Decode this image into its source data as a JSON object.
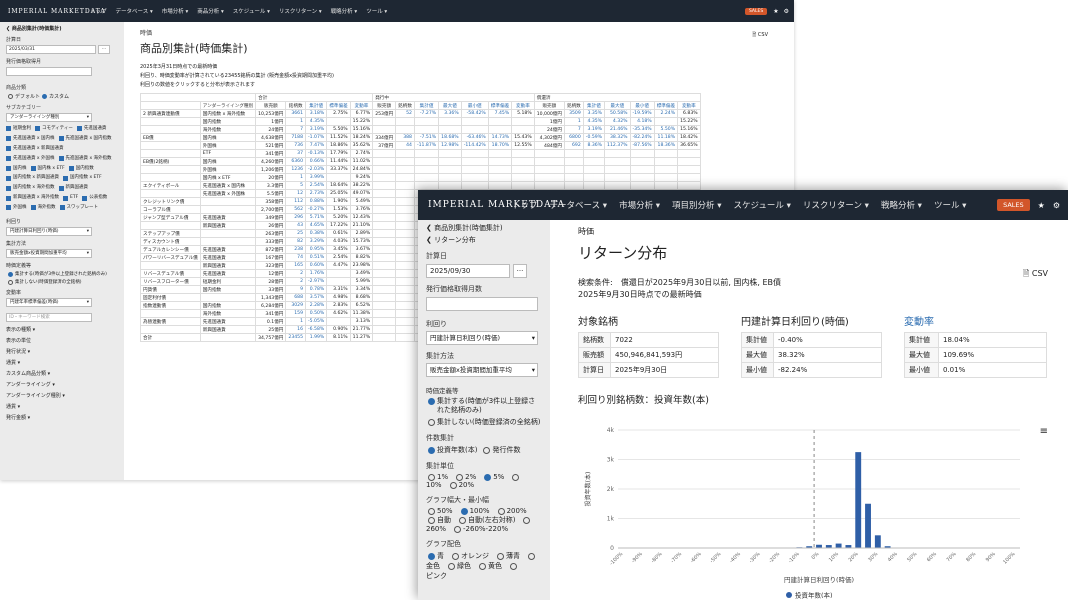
{
  "app": {
    "logo": "IMPERIAL MARKETDATA",
    "nav_small": [
      "トップ",
      "データベース ▾",
      "市場分析 ▾",
      "商品分析 ▾",
      "スケジュール ▾",
      "リスクリターン ▾",
      "戦略分析 ▾",
      "ツール ▾"
    ],
    "nav_large": [
      "トップ",
      "データベース ▾",
      "市場分析 ▾",
      "項目別分析 ▾",
      "スケジュール ▾",
      "リスクリターン ▾",
      "戦略分析 ▾",
      "ツール ▾"
    ],
    "sales": "SALES",
    "star_icon": "★",
    "gear_icon": "⚙"
  },
  "win1": {
    "sidebar": {
      "back": "❮ 商品別集計(時価集計)",
      "date_label": "計算日",
      "date_value": "2025/03/31",
      "date_btn": "...",
      "issuer_label": "発行価格取得月",
      "product_label": "商品分類",
      "product_default": "デフォルト",
      "product_custom": "カスタム",
      "subcat_label": "サブカテゴリー",
      "subcat_value": "アンダーライイング種別",
      "checks": [
        "短期金利",
        "コモディティー",
        "先進国通貨",
        "先進国通貨 x 国内株",
        "先進国通貨 x 国内指数",
        "先進国通貨 x 新興国通貨",
        "先進国通貨 x 外国株",
        "先進国通貨 x 海外指数",
        "国内株",
        "国内株 x ETF",
        "国内指数",
        "国内指数 x 新興国通貨",
        "国内指数 x ETF",
        "国内指数 x 海外指数",
        "新興国通貨",
        "新興国通貨 x 海外指数",
        "ETF",
        "公表指数",
        "外国株",
        "海外指数",
        "スワップレート"
      ],
      "yield_label": "利回り",
      "yield_value": "円建計算日利回り(時価)",
      "agg_label": "集計方法",
      "agg_value": "販売金額x投資期間加重平均",
      "period_label": "時価定義等",
      "period_opt1": "集計する(時価が3件以上登録された銘柄のみ)",
      "period_opt2": "集計しない(時価登録済の全銘柄)",
      "change_label": "変動率",
      "change_value": "円建年率標準偏差(時価)",
      "search_placeholder": "ID・キーワード検索",
      "links": [
        "表示の種類 ▾",
        "表示の単位",
        "発行状況 ▾",
        "通貨 ▾",
        "カスタム商品分類 ▾",
        "アンダーライイング ▾",
        "アンダーライイング種別 ▾",
        "通貨 ▾",
        "発行金額 ▾"
      ]
    },
    "main": {
      "subtitle": "時価",
      "title": "商品別集計(時価集計)",
      "desc1": "2025年3月31日時点での最新時価",
      "desc2": "利回り、時価変動率が計算されている23455銘柄の集計 (販売金額x投資期間加重平均)",
      "desc3": "利回りの数値をクリックすると分布が表示されます",
      "csv": "CSV",
      "group_headers": [
        "合計",
        "発行中",
        "償還済"
      ],
      "yield_header": "円建計算日利回り(時価)",
      "col_headers": [
        "アンダーライイング種別",
        "販売額",
        "銘柄数",
        "集計値",
        "標準偏差",
        "変動率",
        "最大値",
        "最小値"
      ],
      "rows": [
        [
          "2 新興通貨連動債",
          "国内指数 x 海外指数",
          "10,253億円",
          "3661",
          "3.18%",
          "2.75%",
          "6.77%"
        ],
        [
          "",
          "国内指数",
          "1億円",
          "1",
          "4.35%",
          "",
          "15.22%"
        ],
        [
          "",
          "海外指数",
          "24億円",
          "7",
          "3.19%",
          "5.50%",
          "15.16%"
        ],
        [
          "EB債",
          "国内株",
          "4,638億円",
          "7188",
          "-1.07%",
          "11.52%",
          "18.24%"
        ],
        [
          "",
          "外国株",
          "521億円",
          "736",
          "7.47%",
          "18.86%",
          "35.62%"
        ],
        [
          "",
          "ETF",
          "341億円",
          "37",
          "-0.13%",
          "17.79%",
          "2.74%"
        ],
        [
          "EB債(2銘柄)",
          "国内株",
          "4,260億円",
          "6360",
          "0.66%",
          "11.44%",
          "11.02%"
        ],
        [
          "",
          "外国株",
          "1,206億円",
          "1236",
          "-2.03%",
          "33.37%",
          "24.84%"
        ],
        [
          "",
          "国内株 x ETF",
          "20億円",
          "1",
          "3.99%",
          "",
          "9.24%"
        ],
        [
          "エクイティポール",
          "先進国通貨 x 国内株",
          "3.3億円",
          "5",
          "2.54%",
          "18.64%",
          "38.22%"
        ],
        [
          "",
          "先進国通貨 x 外国株",
          "5.5億円",
          "12",
          "2.73%",
          "25.05%",
          "49.07%"
        ],
        [
          "クレジットリンク債",
          "",
          "358億円",
          "112",
          "0.88%",
          "1.90%",
          "5.49%"
        ],
        [
          "コーラブル債",
          "",
          "2,700億円",
          "562",
          "-0.27%",
          "1.53%",
          "3.76%"
        ],
        [
          "ジャンプ型デュアル債",
          "先進国通貨",
          "349億円",
          "296",
          "5.71%",
          "5.20%",
          "12.43%"
        ],
        [
          "",
          "新興国通貨",
          "26億円",
          "43",
          "4.65%",
          "17.22%",
          "21.10%"
        ],
        [
          "ステップアップ債",
          "",
          "263億円",
          "25",
          "0.38%",
          "0.61%",
          "2.89%"
        ],
        [
          "ディスカウント債",
          "",
          "333億円",
          "82",
          "3.29%",
          "4.03%",
          "15.73%"
        ],
        [
          "デュアルカレンシー債",
          "先進国通貨",
          "872億円",
          "238",
          "0.95%",
          "3.45%",
          "3.67%"
        ],
        [
          "パワーリバースデュアル債",
          "先進国通貨",
          "167億円",
          "74",
          "0.51%",
          "2.54%",
          "8.82%"
        ],
        [
          "",
          "新興国通貨",
          "323億円",
          "165",
          "0.60%",
          "4.47%",
          "23.98%"
        ],
        [
          "リバースデュアル債",
          "先進国通貨",
          "12億円",
          "2",
          "1.76%",
          "",
          "3.49%"
        ],
        [
          "リバースフローター債",
          "短期金利",
          "28億円",
          "2",
          "-2.97%",
          "",
          "5.99%"
        ],
        [
          "円貨債",
          "国内指数",
          "33億円",
          "9",
          "0.78%",
          "3.31%",
          "3.34%"
        ],
        [
          "固定利付債",
          "",
          "1,343億円",
          "688",
          "3.57%",
          "4.98%",
          "8.68%"
        ],
        [
          "指数連動債",
          "国内指数",
          "6,284億円",
          "3029",
          "2.28%",
          "2.83%",
          "6.52%"
        ],
        [
          "",
          "海外指数",
          "341億円",
          "159",
          "0.50%",
          "4.62%",
          "11.38%"
        ],
        [
          "為替連動債",
          "先進国通貨",
          "0.1億円",
          "1",
          "-5.05%",
          "",
          "3.13%"
        ],
        [
          "",
          "新興国通貨",
          "25億円",
          "16",
          "-6.58%",
          "0.90%",
          "21.77%"
        ],
        [
          "合計",
          "",
          "34,757億円",
          "23455",
          "1.99%",
          "8.11%",
          "11.27%"
        ]
      ],
      "mid_rows": [
        [
          "253億円",
          "52",
          "-7.27%",
          "3.36%",
          "-58.42%",
          "7.45%",
          "5.18%"
        ],
        [
          "",
          "",
          "",
          "",
          "",
          "",
          ""
        ],
        [
          "",
          "",
          "",
          "",
          "",
          "",
          ""
        ],
        [
          "334億円",
          "388",
          "-7.51%",
          "18.68%",
          "-63.46%",
          "14.73%",
          "15.43%"
        ],
        [
          "37億円",
          "44",
          "-11.87%",
          "12.98%",
          "-114.42%",
          "18.70%",
          "12.55%"
        ]
      ],
      "right_rows": [
        [
          "10,000億円",
          "3509",
          "3.35%",
          "50.58%",
          "-19.59%",
          "2.24%",
          "6.83%"
        ],
        [
          "1億円",
          "1",
          "4.35%",
          "4.32%",
          "4.18%",
          "",
          "15.22%"
        ],
        [
          "24億円",
          "7",
          "3.19%",
          "21.46%",
          "-35.34%",
          "5.50%",
          "15.16%"
        ],
        [
          "4,302億円",
          "6800",
          "-0.59%",
          "38.32%",
          "-82.24%",
          "11.18%",
          "18.42%"
        ],
        [
          "484億円",
          "692",
          "8.36%",
          "112.37%",
          "-87.56%",
          "18.36%",
          "36.65%"
        ]
      ]
    }
  },
  "win2": {
    "sidebar": {
      "back": "❮ 商品別集計(時価集計)",
      "back2": "❮ リターン分布",
      "date_label": "計算日",
      "date_value": "2025/09/30",
      "date_btn": "...",
      "issuer_label": "発行価格取得月数",
      "yield_label": "利回り",
      "yield_value": "円建計算日利回り(時価)",
      "agg_label": "集計方法",
      "agg_value": "販売金額x投資期間加重平均",
      "period_label": "時価定義等",
      "period_opt1": "集計する(時価が3件以上登録された銘柄のみ)",
      "period_opt2": "集計しない(時価登録済の全銘柄)",
      "count_label": "件数集計",
      "count_opt1": "投資年数(本)",
      "count_opt2": "発行件数",
      "unit_label": "集計単位",
      "units": [
        "1%",
        "2%",
        "5%",
        "10%",
        "20%"
      ],
      "range_label": "グラフ幅大・最小幅",
      "ranges": [
        "50%",
        "100%",
        "200%",
        "自動",
        "自動(左右対称)",
        "260%",
        "-260%-220%"
      ],
      "color_label": "グラフ配色",
      "colors": [
        "青",
        "オレンジ",
        "薄青",
        "金色",
        "緑色",
        "黄色",
        "ピンク"
      ]
    },
    "main": {
      "subtitle": "時価",
      "title": "リターン分布",
      "cond1": "検索条件:　償還日が2025年9月30日以前, 国内株, EB債",
      "cond2": "2025年9月30日時点での最新時価",
      "csv": "CSV",
      "box1_title": "対象銘柄",
      "box1": [
        [
          "銘柄数",
          "7022"
        ],
        [
          "販売額",
          "450,946,841,593円"
        ],
        [
          "計算日",
          "2025年9月30日"
        ]
      ],
      "box2_title": "円建計算日利回り(時価)",
      "box2": [
        [
          "集計値",
          "-0.40%"
        ],
        [
          "最大値",
          "38.32%"
        ],
        [
          "最小値",
          "-82.24%"
        ]
      ],
      "box3_title": "変動率",
      "box3": [
        [
          "集計値",
          "18.04%"
        ],
        [
          "最大値",
          "109.69%"
        ],
        [
          "最小値",
          "0.01%"
        ]
      ],
      "chart_title": "利回り別銘柄数：投資年数(本)",
      "menu_icon": "≡"
    }
  },
  "chart_data": {
    "type": "bar",
    "title": "",
    "xlabel": "円建計算日利回り(時価)",
    "ylabel": "投資年数(本)",
    "ylim": [
      0,
      4000
    ],
    "yticks": [
      "0",
      "1k",
      "2k",
      "3k",
      "4k"
    ],
    "categories": [
      "-100%",
      "-95%",
      "-90%",
      "-85%",
      "-80%",
      "-75%",
      "-70%",
      "-65%",
      "-60%",
      "-55%",
      "-50%",
      "-45%",
      "-40%",
      "-35%",
      "-30%",
      "-25%",
      "-20%",
      "-15%",
      "-10%",
      "-5%",
      "0%",
      "5%",
      "10%",
      "15%",
      "20%",
      "25%",
      "30%",
      "35%",
      "40%",
      "45%",
      "50%",
      "55%",
      "60%",
      "65%",
      "70%",
      "75%",
      "80%",
      "85%",
      "90%",
      "95%",
      "100%"
    ],
    "series": [
      {
        "name": "投資年数(本)",
        "values": [
          0,
          0,
          0,
          0,
          0,
          0,
          0,
          0,
          0,
          0,
          0,
          0,
          0,
          0,
          0,
          5,
          10,
          15,
          25,
          60,
          110,
          100,
          150,
          100,
          3250,
          1500,
          430,
          60,
          0,
          0,
          0,
          0,
          0,
          0,
          0,
          0,
          0,
          0,
          0,
          0,
          0
        ]
      }
    ],
    "legend": "bottom-center",
    "bar_color": "#2f5fa7"
  }
}
